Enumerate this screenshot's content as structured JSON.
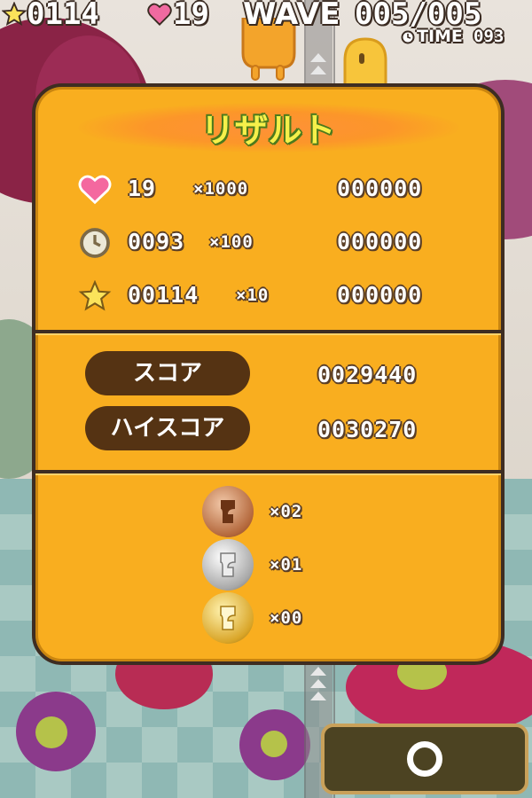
{
  "hud": {
    "stars": "0114",
    "hearts": "19",
    "wave_label": "WAVE",
    "wave_value": "005/005",
    "time_label": "TIME",
    "time_value": "093"
  },
  "result": {
    "title": "リザルト",
    "bonus_rows": [
      {
        "icon": "heart-icon",
        "count": "19",
        "multiplier": "×1000",
        "points": "000000"
      },
      {
        "icon": "clock-icon",
        "count": "0093",
        "multiplier": "×100",
        "points": "000000"
      },
      {
        "icon": "star-icon",
        "count": "00114",
        "multiplier": "×10",
        "points": "000000"
      }
    ],
    "score_label": "スコア",
    "score_value": "0029440",
    "highscore_label": "ハイスコア",
    "highscore_value": "0030270",
    "medals": [
      {
        "icon": "bronze-medal-icon",
        "count": "×02"
      },
      {
        "icon": "silver-medal-icon",
        "count": "×01"
      },
      {
        "icon": "gold-medal-icon",
        "count": "×00"
      }
    ]
  },
  "ok_button": {
    "icon": "circle-ok-icon"
  },
  "colors": {
    "panel": "#f9ae1f",
    "panel_border": "#3e2d22",
    "pill": "#553313",
    "title": "#f6f04a"
  }
}
